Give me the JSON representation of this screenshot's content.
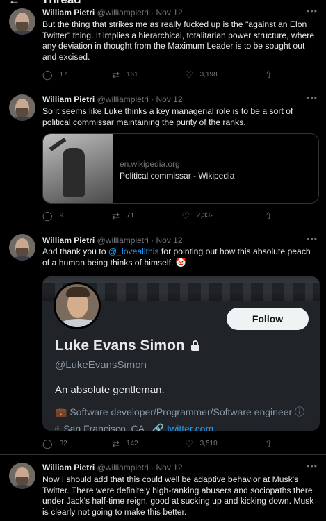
{
  "header": {
    "title": "Thread",
    "back_icon": "←"
  },
  "tweets": [
    {
      "name": "William Pietri",
      "handle": "@williampietri",
      "dot": "·",
      "date": "Nov 12",
      "text": "But the thing that strikes me as really fucked up is the \"against an Elon Twitter\" thing. It implies a hierarchical, totalitarian power structure, where any deviation in thought from the Maximum Leader is to be sought out and excised.",
      "replies": "17",
      "retweets": "161",
      "likes": "3,198"
    },
    {
      "name": "William Pietri",
      "handle": "@williampietri",
      "dot": "·",
      "date": "Nov 12",
      "text": "So it seems like Luke thinks a key managerial role is to be a sort of political commissar maintaining the purity of the ranks.",
      "card": {
        "domain": "en.wikipedia.org",
        "title": "Political commissar - Wikipedia"
      },
      "replies": "9",
      "retweets": "71",
      "likes": "2,332"
    },
    {
      "name": "William Pietri",
      "handle": "@williampietri",
      "dot": "·",
      "date": "Nov 12",
      "text_before": "And thank you to ",
      "mention": "@_loveallthis",
      "text_after": " for pointing out how this absolute peach of a human being thinks of himself. 🤡",
      "profile": {
        "follow_label": "Follow",
        "name": "Luke Evans Simon",
        "handle": "@LukeEvansSimon",
        "bio": "An absolute gentleman.",
        "job": "💼 Software developer/Programmer/Software engineer ⓘ",
        "location": "⌾ San Francisco, CA",
        "url": "🔗 twitter.com"
      },
      "replies": "32",
      "retweets": "142",
      "likes": "3,510"
    },
    {
      "name": "William Pietri",
      "handle": "@williampietri",
      "dot": "·",
      "date": "Nov 12",
      "text": "Now I should add that this could well be adaptive behavior at Musk's Twitter. There were definitely high-ranking abusers and sociopaths there under Jack's half-time reign, good at sucking up and kicking down. Musk is clearly not going to make this better."
    }
  ],
  "icons": {
    "reply": "◯",
    "retweet": "⇄",
    "like": "♡",
    "share": "⇧",
    "more": "•••"
  }
}
